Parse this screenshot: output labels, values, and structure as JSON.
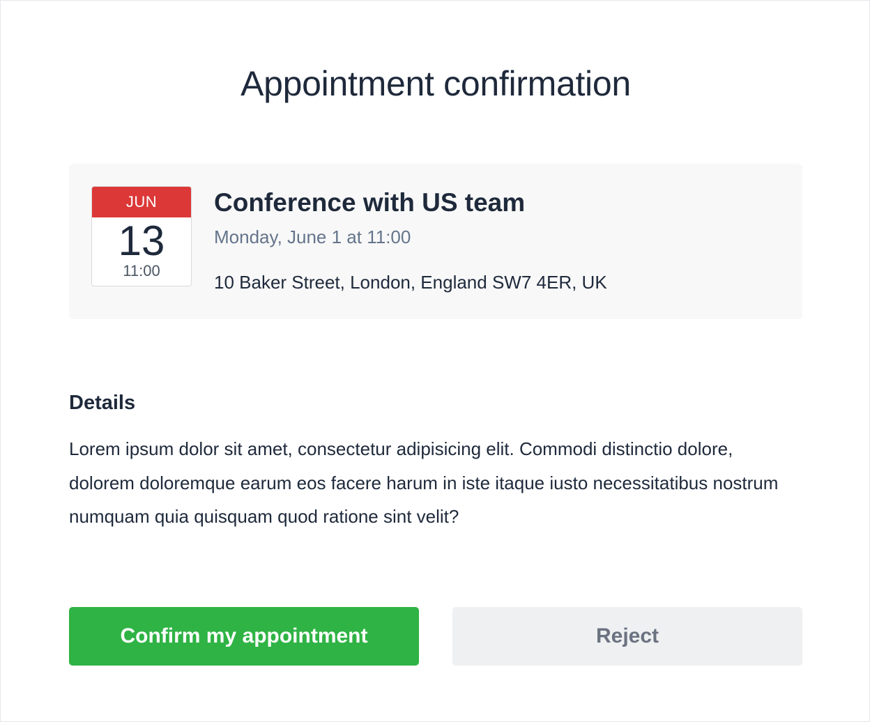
{
  "page": {
    "title": "Appointment confirmation"
  },
  "event": {
    "calendar": {
      "month": "JUN",
      "day": "13",
      "time": "11:00"
    },
    "name": "Conference with US team",
    "when": "Monday, June 1 at 11:00",
    "where": "10 Baker Street, London, England SW7 4ER, UK"
  },
  "details": {
    "heading": "Details",
    "text": "Lorem ipsum dolor sit amet, consectetur adipisicing elit. Commodi distinctio dolore, dolorem doloremque earum eos facere harum in iste itaque iusto necessitatibus nostrum numquam quia quisquam quod ratione sint velit?"
  },
  "actions": {
    "confirm_label": "Confirm my appointment",
    "reject_label": "Reject"
  },
  "colors": {
    "confirm": "#2fb344",
    "reject_bg": "#eef0f2",
    "calendar_header": "#dc3838",
    "card_bg": "#f8f8f8"
  }
}
